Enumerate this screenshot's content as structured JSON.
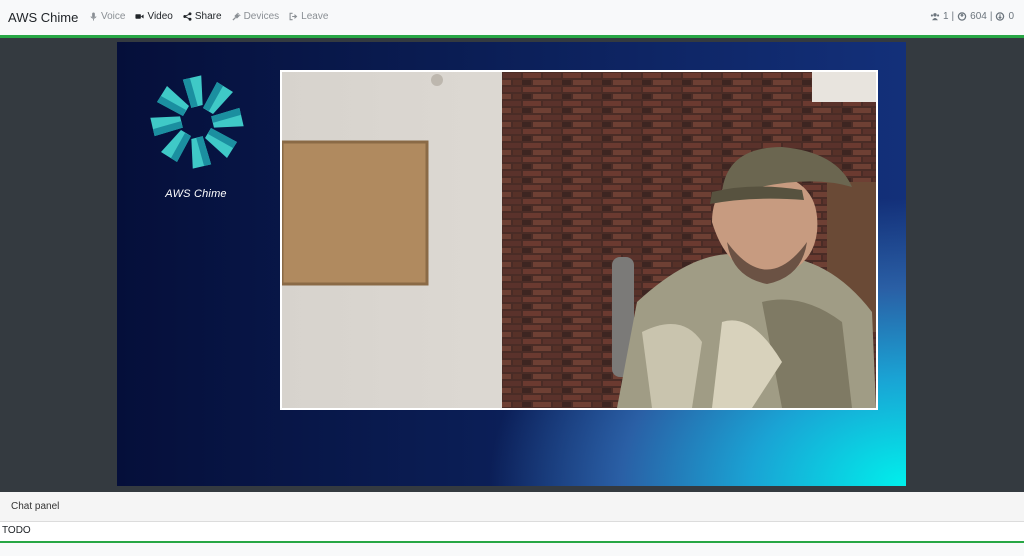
{
  "app": {
    "title": "AWS Chime"
  },
  "nav": [
    {
      "label": "Voice",
      "icon": "microphone-icon",
      "active": false
    },
    {
      "label": "Video",
      "icon": "video-camera-icon",
      "active": true
    },
    {
      "label": "Share",
      "icon": "share-icon",
      "active": false
    },
    {
      "label": "Devices",
      "icon": "plug-icon",
      "active": false
    },
    {
      "label": "Leave",
      "icon": "sign-out-icon",
      "active": false
    }
  ],
  "stats": {
    "participants": "1",
    "separator1": "|",
    "bitrate": "604",
    "separator2": "|",
    "other": "0"
  },
  "stage": {
    "title": "AWS Chime"
  },
  "chat": {
    "header": "Chat panel",
    "body": "TODO"
  },
  "colors": {
    "accent": "#28a745",
    "navbar": "#f8f9fa",
    "background": "#343a40"
  }
}
